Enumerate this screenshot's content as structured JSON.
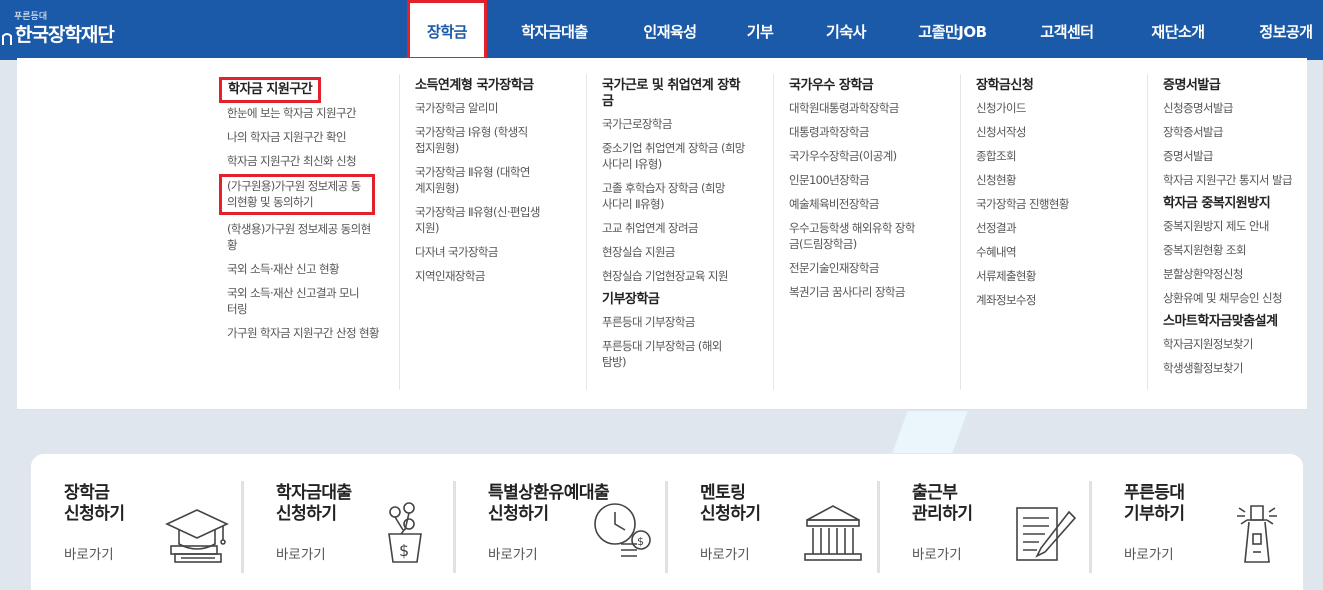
{
  "header": {
    "logo_sub": "푸른등대",
    "logo_main": "한국장학재단",
    "nav": [
      {
        "label": "장학금",
        "active": true
      },
      {
        "label": "학자금대출",
        "active": false
      },
      {
        "label": "인재육성",
        "active": false
      },
      {
        "label": "기부",
        "active": false
      },
      {
        "label": "기숙사",
        "active": false
      },
      {
        "label": "고졸만JOB",
        "active": false
      },
      {
        "label": "고객센터",
        "active": false
      },
      {
        "label": "재단소개",
        "active": false
      },
      {
        "label": "정보공개",
        "active": false
      }
    ]
  },
  "menu": {
    "columns": [
      {
        "title": "학자금 지원구간",
        "links": [
          "한눈에 보는 학자금 지원구간",
          "나의 학자금 지원구간 확인",
          "학자금 지원구간 최신화 신청",
          "(가구원용)가구원 정보제공 동의현황 및 동의하기",
          "(학생용)가구원 정보제공 동의현황",
          "국외 소득·재산 신고 현황",
          "국외 소득·재산 신고결과 모니터링",
          "가구원 학자금 지원구간 산정 현황"
        ]
      },
      {
        "title": "소득연계형 국가장학금",
        "links": [
          "국가장학금 알리미",
          "국가장학금 Ⅰ유형 (학생직접지원형)",
          "국가장학금 Ⅱ유형 (대학연계지원형)",
          "국가장학금 Ⅱ유형(신·편입생지원)",
          "다자녀 국가장학금",
          "지역인재장학금"
        ]
      },
      {
        "title": "국가근로 및 취업연계 장학금",
        "links": [
          "국가근로장학금",
          "중소기업 취업연계 장학금 (희망사다리 Ⅰ유형)",
          "고졸 후학습자 장학금 (희망사다리 Ⅱ유형)",
          "고교 취업연계 장려금",
          "현장실습 지원금",
          "현장실습 기업현장교육 지원"
        ],
        "title2": "기부장학금",
        "links2": [
          "푸른등대 기부장학금",
          "푸른등대 기부장학금 (해외탐방)"
        ]
      },
      {
        "title": "국가우수 장학금",
        "links": [
          "대학원대통령과학장학금",
          "대통령과학장학금",
          "국가우수장학금(이공계)",
          "인문100년장학금",
          "예술체육비전장학금",
          "우수고등학생 해외유학 장학금(드림장학금)",
          "전문기술인재장학금",
          "복권기금 꿈사다리 장학금"
        ]
      },
      {
        "title": "장학금신청",
        "links": [
          "신청가이드",
          "신청서작성",
          "종합조회",
          "신청현황",
          "국가장학금 진행현황",
          "선정결과",
          "수혜내역",
          "서류제출현황",
          "계좌정보수정"
        ]
      },
      {
        "title": "증명서발급",
        "links": [
          "신청증명서발급",
          "장학증서발급",
          "증명서발급",
          "학자금 지원구간 통지서 발급"
        ],
        "title2": "학자금 중복지원방지",
        "links2": [
          "중복지원방지 제도 안내",
          "중복지원현황 조회",
          "분할상환약정신청",
          "상환유예 및 채무승인 신청"
        ],
        "title3": "스마트학자금맞춤설계",
        "links3": [
          "학자금지원정보찾기",
          "학생생활정보찾기"
        ]
      }
    ]
  },
  "quick": {
    "more_label": "바로가기",
    "items": [
      {
        "title": "장학금\n신청하기",
        "icon": "graduation-cap-icon"
      },
      {
        "title": "학자금대출\n신청하기",
        "icon": "money-plant-icon"
      },
      {
        "title": "특별상환유예대출\n신청하기",
        "icon": "clock-coins-icon"
      },
      {
        "title": "멘토링\n신청하기",
        "icon": "building-icon"
      },
      {
        "title": "출근부\n관리하기",
        "icon": "notepad-pen-icon"
      },
      {
        "title": "푸른등대\n기부하기",
        "icon": "lighthouse-icon"
      }
    ]
  },
  "colors": {
    "brand": "#1a5aa8",
    "highlight": "#e3212b"
  }
}
